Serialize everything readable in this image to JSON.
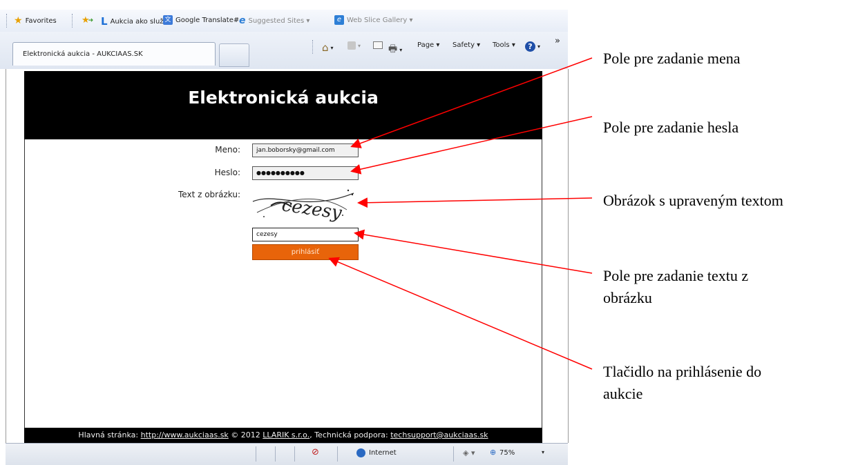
{
  "browser": {
    "favorites_bar": {
      "favorites_label": "Favorites",
      "items": [
        "Aukcia ako služba",
        "Google Translate#",
        "Suggested Sites ▾",
        "Web Slice Gallery ▾"
      ]
    },
    "tab": {
      "title": "Elektronická aukcia - AUKCIAAS.SK"
    },
    "command_bar": {
      "page": "Page ▾",
      "safety": "Safety ▾",
      "tools": "Tools ▾",
      "more": "»"
    },
    "status_bar": {
      "zone": "Internet",
      "zoom": "75%"
    }
  },
  "site": {
    "title": "Elektronická aukcia",
    "form": {
      "name_label": "Meno:",
      "name_value": "jan.boborsky@gmail.com",
      "password_label": "Heslo:",
      "password_value": "●●●●●●●●●●",
      "captcha_label": "Text z obrázku:",
      "captcha_text": "cezesy",
      "captcha_input_value": "cezesy",
      "login_button": "prihlásiť"
    },
    "footer": {
      "home_label": "Hlavná stránka:",
      "home_url": "http://www.aukciaas.sk",
      "copyright": "© 2012",
      "company": "LLARIK s.r.o.",
      "support_label": "Technická podpora:",
      "support_email": "techsupport@aukciaas.sk"
    }
  },
  "annotations": {
    "name_field": "Pole pre zadanie mena",
    "password_field": "Pole pre zadanie hesla",
    "captcha_image": "Obrázok s upraveným textom",
    "captcha_field_line1": "Pole pre zadanie textu z",
    "captcha_field_line2": "obrázku",
    "login_button_line1": "Tlačidlo na prihlásenie do",
    "login_button_line2": "aukcie",
    "arrow_color": "#ff0000"
  },
  "colors": {
    "header_bg": "#000000",
    "button_bg": "#e8640a"
  }
}
